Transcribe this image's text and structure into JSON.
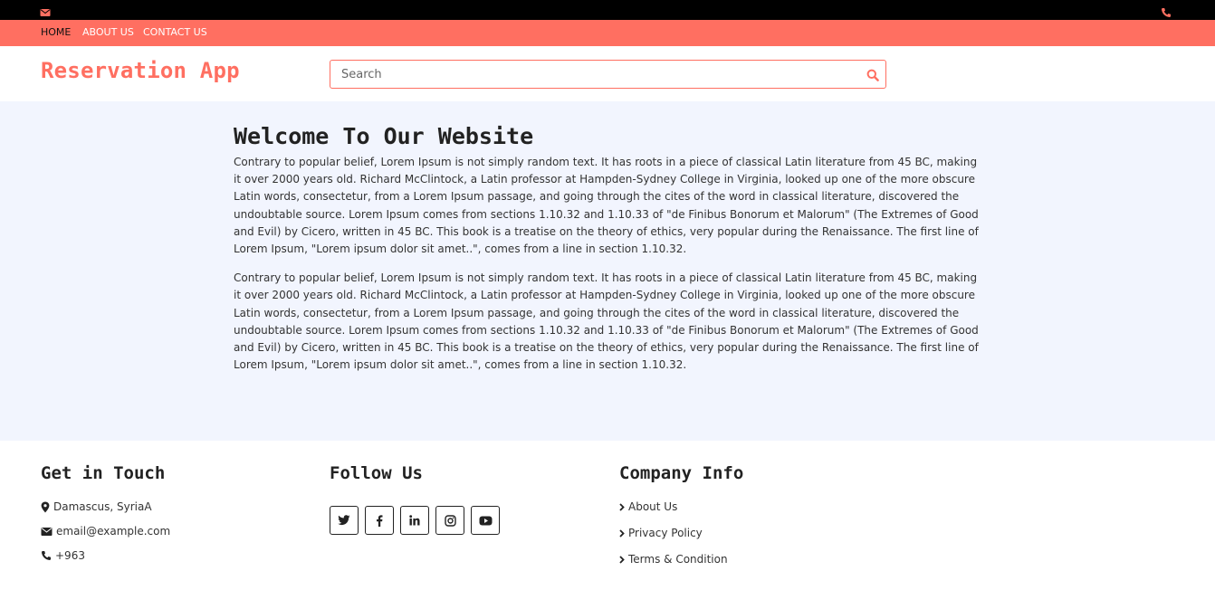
{
  "colors": {
    "accent": "#ff6f61",
    "topbar": "#000000",
    "main_bg": "#f2f5fe"
  },
  "topbar": {
    "left_icon": "envelope-icon",
    "right_icon": "phone-icon"
  },
  "nav": {
    "items": [
      {
        "label": "HOME"
      },
      {
        "label": "ABOUT US"
      },
      {
        "label": "CONTACT US"
      }
    ]
  },
  "header": {
    "brand": "Reservation App",
    "search_placeholder": "Search",
    "search_icon": "search-icon"
  },
  "main": {
    "title": "Welcome To Our Website",
    "paragraphs": [
      "Contrary to popular belief, Lorem Ipsum is not simply random text. It has roots in a piece of classical Latin literature from 45 BC, making it over 2000 years old. Richard McClintock, a Latin professor at Hampden-Sydney College in Virginia, looked up one of the more obscure Latin words, consectetur, from a Lorem Ipsum passage, and going through the cites of the word in classical literature, discovered the undoubtable source. Lorem Ipsum comes from sections 1.10.32 and 1.10.33 of \"de Finibus Bonorum et Malorum\" (The Extremes of Good and Evil) by Cicero, written in 45 BC. This book is a treatise on the theory of ethics, very popular during the Renaissance. The first line of Lorem Ipsum, \"Lorem ipsum dolor sit amet..\", comes from a line in section 1.10.32.",
      "Contrary to popular belief, Lorem Ipsum is not simply random text. It has roots in a piece of classical Latin literature from 45 BC, making it over 2000 years old. Richard McClintock, a Latin professor at Hampden-Sydney College in Virginia, looked up one of the more obscure Latin words, consectetur, from a Lorem Ipsum passage, and going through the cites of the word in classical literature, discovered the undoubtable source. Lorem Ipsum comes from sections 1.10.32 and 1.10.33 of \"de Finibus Bonorum et Malorum\" (The Extremes of Good and Evil) by Cicero, written in 45 BC. This book is a treatise on the theory of ethics, very popular during the Renaissance. The first line of Lorem Ipsum, \"Lorem ipsum dolor sit amet..\", comes from a line in section 1.10.32."
    ]
  },
  "footer": {
    "contact": {
      "title": "Get in Touch",
      "items": [
        {
          "icon": "map-marker-icon",
          "text": "Damascus, SyriaA"
        },
        {
          "icon": "envelope-icon",
          "text": "email@example.com"
        },
        {
          "icon": "phone-icon",
          "text": "+963"
        }
      ]
    },
    "follow": {
      "title": "Follow Us",
      "icons": [
        "twitter-icon",
        "facebook-icon",
        "linkedin-icon",
        "instagram-icon",
        "youtube-icon"
      ]
    },
    "company": {
      "title": "Company Info",
      "links": [
        {
          "icon": "chevron-right-icon",
          "text": "About Us"
        },
        {
          "icon": "chevron-right-icon",
          "text": "Privacy Policy"
        },
        {
          "icon": "chevron-right-icon",
          "text": "Terms & Condition"
        }
      ]
    }
  }
}
